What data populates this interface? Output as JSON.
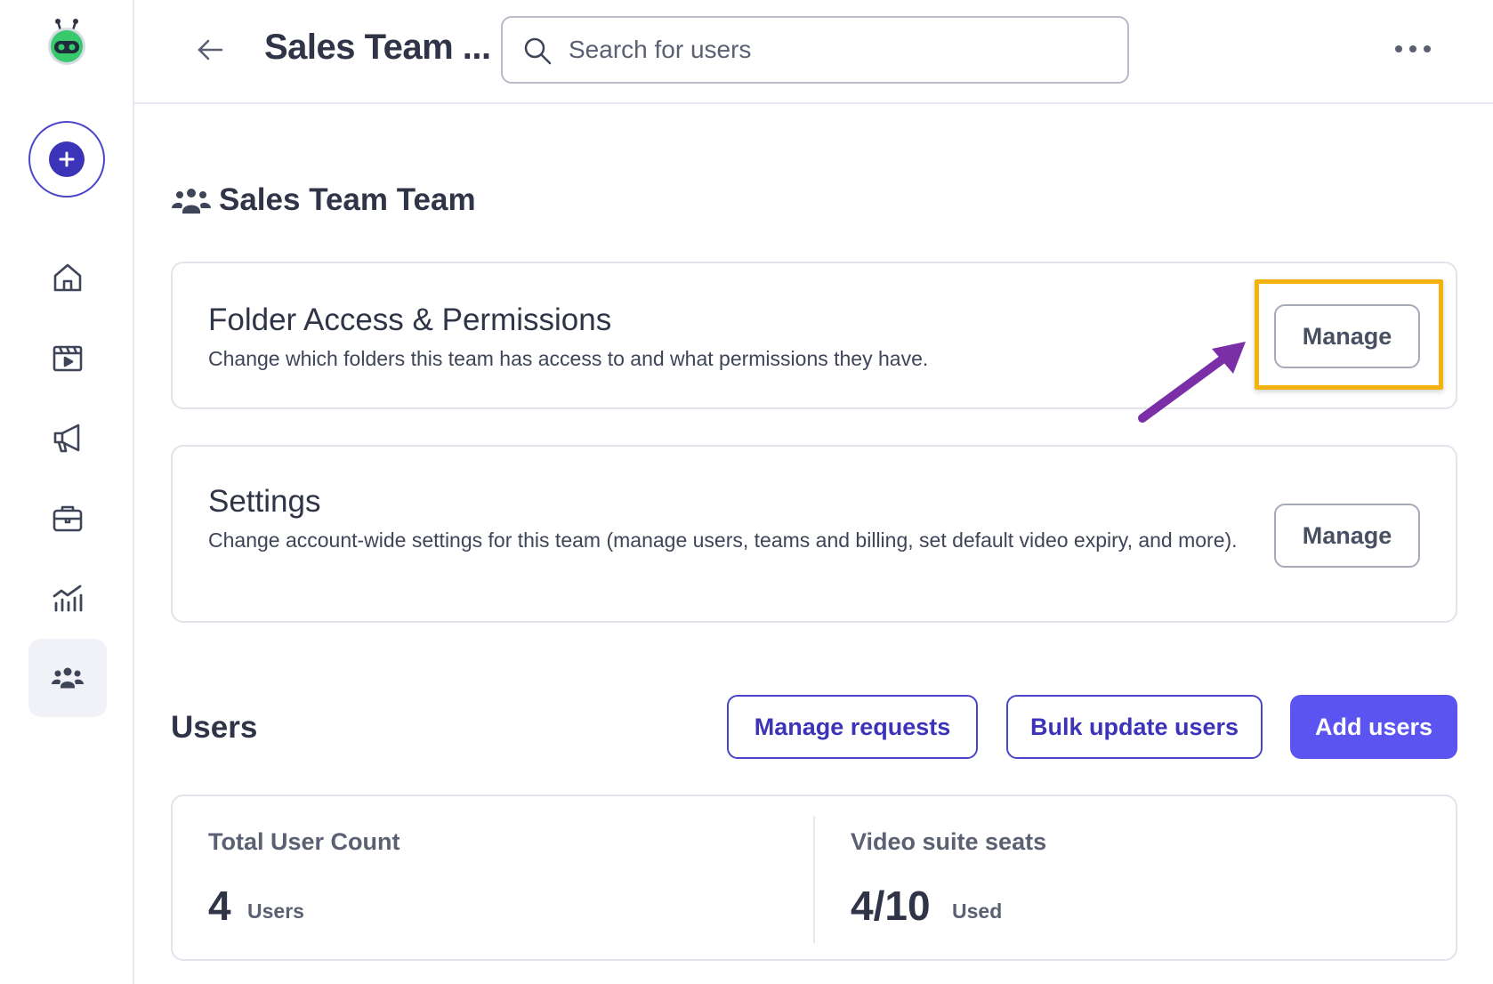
{
  "header": {
    "title": "Sales Team ...",
    "search_placeholder": "Search for users"
  },
  "sidebar": {
    "items": [
      {
        "name": "home"
      },
      {
        "name": "videos"
      },
      {
        "name": "campaigns"
      },
      {
        "name": "tools"
      },
      {
        "name": "analytics"
      },
      {
        "name": "teams",
        "active": true
      }
    ]
  },
  "team": {
    "heading": "Sales Team Team"
  },
  "cards": {
    "folder_access": {
      "title": "Folder Access & Permissions",
      "description": "Change which folders this team has access to and what permissions they have.",
      "button": "Manage"
    },
    "settings": {
      "title": "Settings",
      "description": "Change account-wide settings for this team (manage users, teams and billing, set default video expiry, and more).",
      "button": "Manage"
    }
  },
  "users": {
    "title": "Users",
    "manage_requests": "Manage requests",
    "bulk_update": "Bulk update users",
    "add_users": "Add users"
  },
  "stats": {
    "total": {
      "label": "Total User Count",
      "value": "4",
      "unit": "Users"
    },
    "seats": {
      "label": "Video suite seats",
      "value": "4/10",
      "unit": "Used"
    }
  },
  "colors": {
    "accent": "#5b54f0",
    "accent_dark": "#3b34b8",
    "highlight": "#f3b20d",
    "annotation_arrow": "#7b2fa6",
    "logo_green": "#37c96b"
  }
}
